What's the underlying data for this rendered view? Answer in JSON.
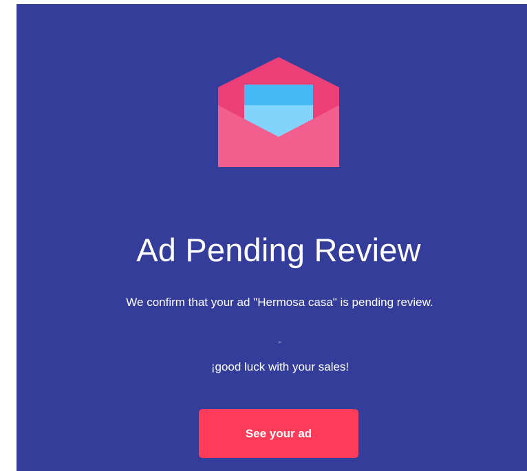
{
  "email": {
    "icon": "envelope-icon",
    "title": "Ad Pending Review",
    "message": "We confirm that your ad \"Hermosa casa\" is pending review.",
    "separator": "-",
    "good_luck": "¡good luck with your sales!",
    "button_label": "See your ad"
  },
  "colors": {
    "background": "#343d9a",
    "button": "#fe3b58",
    "envelope_back": "#ec3f78",
    "envelope_front": "#f25f8e",
    "letter_light": "#82d4fd",
    "letter_dark": "#45b9f3"
  }
}
